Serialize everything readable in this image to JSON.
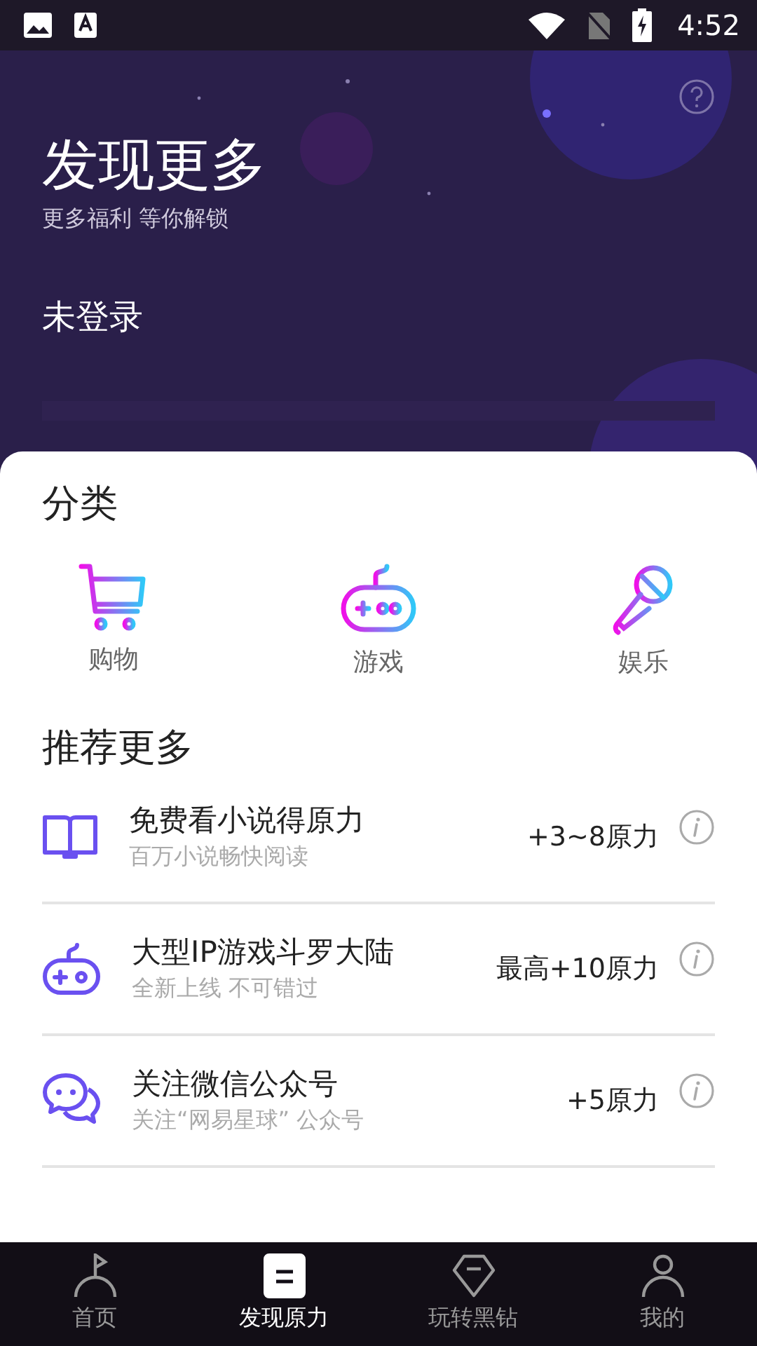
{
  "status_bar": {
    "time": "4:52"
  },
  "header": {
    "title": "发现更多",
    "subtitle": "更多福利 等你解锁",
    "login": "未登录"
  },
  "categories": {
    "title": "分类",
    "items": [
      {
        "label": "购物"
      },
      {
        "label": "游戏"
      },
      {
        "label": "娱乐"
      }
    ]
  },
  "recommend": {
    "title": "推荐更多",
    "tasks": [
      {
        "title": "免费看小说得原力",
        "subtitle": "百万小说畅快阅读",
        "reward": "+3~8原力"
      },
      {
        "title": "大型IP游戏斗罗大陆",
        "subtitle": "全新上线 不可错过",
        "reward": "最高+10原力"
      },
      {
        "title": "关注微信公众号",
        "subtitle": "关注“网易星球” 公众号",
        "reward": "+5原力"
      }
    ]
  },
  "bottom_nav": [
    {
      "label": "首页",
      "selected": false
    },
    {
      "label": "发现原力",
      "selected": true
    },
    {
      "label": "玩转黑钻",
      "selected": false
    },
    {
      "label": "我的",
      "selected": false
    }
  ]
}
